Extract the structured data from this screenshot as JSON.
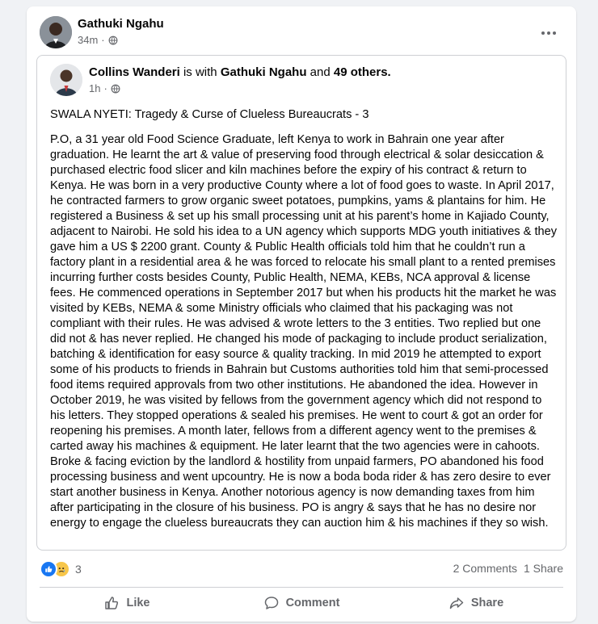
{
  "post": {
    "author": "Gathuki Ngahu",
    "time": "34m",
    "privacy_icon": "globe-icon"
  },
  "shared": {
    "author": "Collins Wanderi",
    "with_text": " is with ",
    "tagged": "Gathuki Ngahu",
    "and_text": " and ",
    "others": "49 others.",
    "time": "1h",
    "title": "SWALA NYETI: Tragedy & Curse of Clueless Bureaucrats - 3",
    "body": "P.O, a 31 year old Food Science Graduate, left Kenya to work in Bahrain one year after graduation. He learnt the art & value of preserving food through electrical & solar desiccation & purchased electric food slicer and kiln machines before the expiry of his contract & return to Kenya. He was born in a very productive County where a lot of food goes to waste. In April 2017, he contracted farmers to grow organic sweet potatoes, pumpkins, yams & plantains for him. He registered a Business & set up his small processing unit at his parent’s home in Kajiado County, adjacent to Nairobi. He sold his idea to a UN agency which supports MDG youth initiatives & they gave him a US $ 2200 grant. County & Public Health officials told him that he couldn’t run a factory plant in a residential area & he was forced to relocate his small plant to a rented premises incurring further costs besides County, Public Health, NEMA, KEBs, NCA approval & license fees. He commenced operations in September 2017 but when his products hit the market he was visited by KEBs, NEMA & some Ministry officials who claimed that his packaging was not compliant with their rules. He was advised & wrote letters to the 3 entities. Two replied but one did not & has never replied. He changed his mode of packaging to include product serialization, batching & identification for easy source & quality tracking. In mid 2019 he attempted to export some of his products to friends in Bahrain but Customs authorities told him that semi-processed food items required approvals from two other institutions. He abandoned the idea. However in October 2019, he was visited by fellows from the government agency which did not respond to his letters. They stopped operations & sealed his premises. He went to court & got an order for reopening his premises. A month later, fellows from a different agency went to the premises & carted away his machines & equipment. He later learnt that the two agencies were in cahoots. Broke & facing eviction by the landlord & hostility from unpaid farmers, PO abandoned his food processing business and went upcountry. He is now a boda boda rider & has zero desire to ever start another business in Kenya. Another notorious agency is now demanding taxes from him after participating in the closure of his business. PO is angry & says that he has no desire nor energy to engage the clueless bureaucrats they can auction him & his machines if they so wish."
  },
  "reactions": {
    "icons": [
      "like-icon",
      "sad-icon"
    ],
    "count": "3",
    "comments": "2 Comments",
    "shares": "1 Share"
  },
  "actions": {
    "like": "Like",
    "comment": "Comment",
    "share": "Share"
  },
  "colors": {
    "accent": "#1877f2",
    "secondary_text": "#65676b",
    "background": "#f0f2f5"
  }
}
